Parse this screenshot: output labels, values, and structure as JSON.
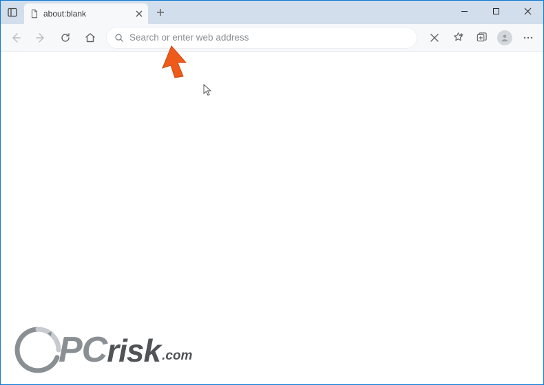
{
  "colors": {
    "window_border": "#0a78d4",
    "tabstrip_bg": "#d2deeb",
    "toolbar_bg": "#f6f8fa",
    "annotation_arrow": "#ee5a1a"
  },
  "tab": {
    "title": "about:blank"
  },
  "address_bar": {
    "placeholder": "Search or enter web address",
    "value": ""
  },
  "watermark": {
    "pc": "PC",
    "risk": "risk",
    "dotcom": ".com"
  }
}
